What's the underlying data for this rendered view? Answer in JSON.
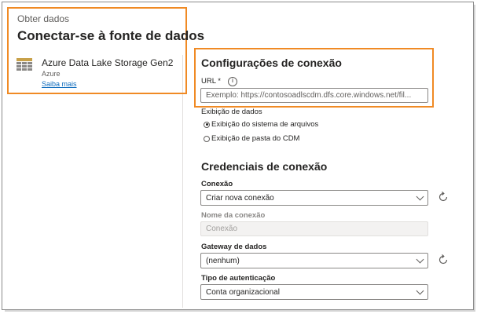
{
  "left": {
    "breadcrumb": "Obter dados",
    "title": "Conectar-se à fonte de dados",
    "source": {
      "name": "Azure Data Lake Storage Gen2",
      "category": "Azure",
      "link": "Saiba mais",
      "icon": "table-grid-icon"
    }
  },
  "connection_settings": {
    "title": "Configurações de conexão",
    "url_label": "URL *",
    "url_placeholder": "Exemplo: https://contosoadlscdm.dfs.core.windows.net/fil...",
    "view_label": "Exibição de dados",
    "options": [
      {
        "label": "Exibição do sistema de arquivos",
        "selected": true
      },
      {
        "label": "Exibição de pasta do CDM",
        "selected": false
      }
    ]
  },
  "credentials": {
    "title": "Credenciais de conexão",
    "connection_label": "Conexão",
    "connection_value": "Criar nova conexão",
    "name_label": "Nome da conexão",
    "name_placeholder": "Conexão",
    "gateway_label": "Gateway de dados",
    "gateway_value": "(nenhum)",
    "auth_label": "Tipo de autenticação",
    "auth_value": "Conta organizacional"
  },
  "colors": {
    "highlight": "#f08a24",
    "link": "#0f6cbd"
  }
}
